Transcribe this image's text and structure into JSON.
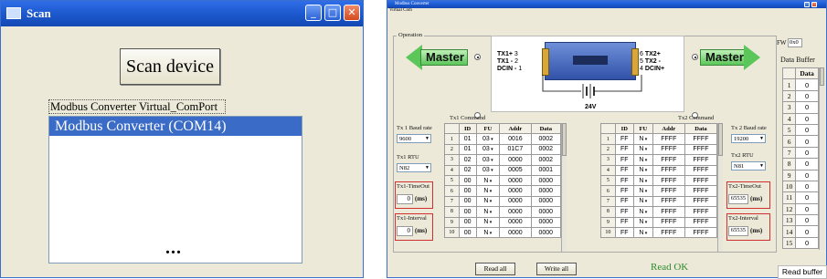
{
  "scan_window": {
    "title": "Scan",
    "scan_button": "Scan device",
    "label": "Modbus Converter Virtual_ComPort",
    "list_items": [
      "Modbus Converter (COM14)"
    ],
    "dots": "..."
  },
  "modbus_window": {
    "title": "Modbus Converter",
    "menu": "Virtual Com",
    "operation_label": "Operation",
    "master_left": "Master",
    "master_right": "Master",
    "diagram": {
      "left_pins": [
        "TX1+",
        "TX1 -",
        "DCIN -"
      ],
      "left_nums": [
        "3",
        "2",
        "1"
      ],
      "right_pins": [
        "TX2+",
        "TX2 -",
        "DCIN+"
      ],
      "right_nums": [
        "6",
        "5",
        "4"
      ],
      "voltage": "24V"
    },
    "tx1": {
      "command_label": "Tx1 Command",
      "baud_label": "Tx 1 Baud rate",
      "baud_value": "9600",
      "rtu_label": "Tx1 RTU",
      "rtu_value": "N82",
      "timeout_label": "Tx1-TimeOut",
      "timeout_value": "0",
      "timeout_unit": "(ms)",
      "interval_label": "Tx1-Interval",
      "interval_value": "0",
      "interval_unit": "(ms)",
      "columns": [
        "",
        "ID",
        "FU",
        "Addr",
        "Data"
      ],
      "rows": [
        [
          "1",
          "01",
          "03",
          "0016",
          "0002"
        ],
        [
          "2",
          "01",
          "03",
          "01C7",
          "0002"
        ],
        [
          "3",
          "02",
          "03",
          "0000",
          "0002"
        ],
        [
          "4",
          "02",
          "03",
          "0005",
          "0001"
        ],
        [
          "5",
          "00",
          "N",
          "0000",
          "0000"
        ],
        [
          "6",
          "00",
          "N",
          "0000",
          "0000"
        ],
        [
          "7",
          "00",
          "N",
          "0000",
          "0000"
        ],
        [
          "8",
          "00",
          "N",
          "0000",
          "0000"
        ],
        [
          "9",
          "00",
          "N",
          "0000",
          "0000"
        ],
        [
          "10",
          "00",
          "N",
          "0000",
          "0000"
        ]
      ]
    },
    "tx2": {
      "command_label": "Tx2 Command",
      "baud_label": "Tx 2 Baud rate",
      "baud_value": "19200",
      "rtu_label": "Tx2 RTU",
      "rtu_value": "N81",
      "timeout_label": "Tx2-TimeOut",
      "timeout_value": "65535",
      "timeout_unit": "(ms)",
      "interval_label": "Tx2-Interval",
      "interval_value": "65535",
      "interval_unit": "(ms)",
      "columns": [
        "",
        "ID",
        "FU",
        "Addr",
        "Data"
      ],
      "rows": [
        [
          "1",
          "FF",
          "N",
          "FFFF",
          "FFFF"
        ],
        [
          "2",
          "FF",
          "N",
          "FFFF",
          "FFFF"
        ],
        [
          "3",
          "FF",
          "N",
          "FFFF",
          "FFFF"
        ],
        [
          "4",
          "FF",
          "N",
          "FFFF",
          "FFFF"
        ],
        [
          "5",
          "FF",
          "N",
          "FFFF",
          "FFFF"
        ],
        [
          "6",
          "FF",
          "N",
          "FFFF",
          "FFFF"
        ],
        [
          "7",
          "FF",
          "N",
          "FFFF",
          "FFFF"
        ],
        [
          "8",
          "FF",
          "N",
          "FFFF",
          "FFFF"
        ],
        [
          "9",
          "FF",
          "N",
          "FFFF",
          "FFFF"
        ],
        [
          "10",
          "FF",
          "N",
          "FFFF",
          "FFFF"
        ]
      ]
    },
    "fw_label": "FW",
    "fw_value": "0x0",
    "data_buffer_label": "Data Buffer",
    "data_buffer": {
      "columns": [
        "",
        "Data"
      ],
      "rows": [
        [
          "1",
          "0"
        ],
        [
          "2",
          "0"
        ],
        [
          "3",
          "0"
        ],
        [
          "4",
          "0"
        ],
        [
          "5",
          "0"
        ],
        [
          "6",
          "0"
        ],
        [
          "7",
          "0"
        ],
        [
          "8",
          "0"
        ],
        [
          "9",
          "0"
        ],
        [
          "10",
          "0"
        ],
        [
          "11",
          "0"
        ],
        [
          "12",
          "0"
        ],
        [
          "13",
          "0"
        ],
        [
          "14",
          "0"
        ],
        [
          "15",
          "0"
        ]
      ]
    },
    "read_all_button": "Read all",
    "write_all_button": "Write all",
    "status": "Read OK",
    "read_buffer_button": "Read buffer",
    "colors": {
      "status": "#2a8a2a",
      "title_bar": "#1a55c9",
      "arrow": "#5bc65a",
      "highlight_border": "#d13030"
    }
  }
}
